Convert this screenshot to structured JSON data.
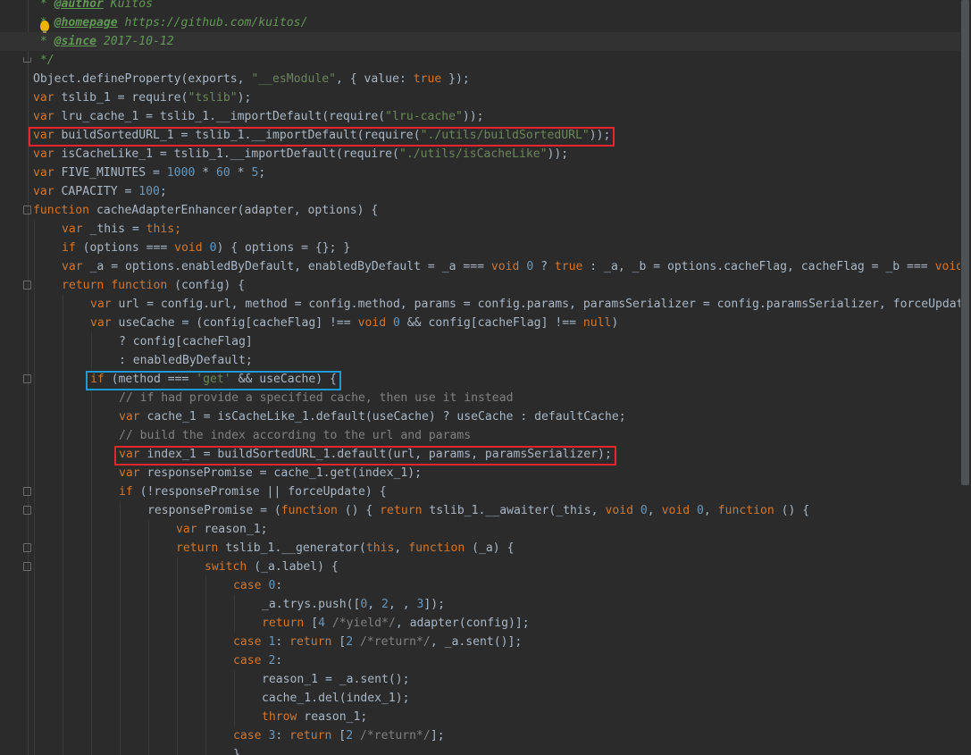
{
  "editor": {
    "lines": [
      {
        "indent": 0,
        "fold": "",
        "current": false,
        "spans": [
          {
            "t": " * ",
            "c": "dcmt"
          },
          {
            "t": "@author",
            "c": "dtag"
          },
          {
            "t": " Kuitos",
            "c": "dcmt"
          }
        ]
      },
      {
        "indent": 0,
        "fold": "",
        "current": false,
        "spans": [
          {
            "t": " * ",
            "c": "dcmt"
          },
          {
            "t": "@homepage",
            "c": "dtag"
          },
          {
            "t": " https://github.com/kuitos/",
            "c": "dcmt"
          }
        ]
      },
      {
        "indent": 0,
        "fold": "",
        "current": true,
        "spans": [
          {
            "t": " * ",
            "c": "dcmt"
          },
          {
            "t": "@since",
            "c": "dtag"
          },
          {
            "t": " 2017-10-12",
            "c": "dcmt"
          }
        ]
      },
      {
        "indent": 0,
        "fold": "end",
        "current": false,
        "spans": [
          {
            "t": " */",
            "c": "dcmt"
          }
        ]
      },
      {
        "indent": 0,
        "fold": "",
        "current": false,
        "spans": [
          {
            "t": "Object.defineProperty(exports, ",
            "c": ""
          },
          {
            "t": "\"__esModule\"",
            "c": "str"
          },
          {
            "t": ", { value: ",
            "c": ""
          },
          {
            "t": "true",
            "c": "kw"
          },
          {
            "t": " });",
            "c": ""
          }
        ]
      },
      {
        "indent": 0,
        "fold": "",
        "current": false,
        "spans": [
          {
            "t": "var",
            "c": "kw"
          },
          {
            "t": " tslib_1 = require(",
            "c": ""
          },
          {
            "t": "\"tslib\"",
            "c": "str"
          },
          {
            "t": ");",
            "c": ""
          }
        ]
      },
      {
        "indent": 0,
        "fold": "",
        "current": false,
        "spans": [
          {
            "t": "var",
            "c": "kw"
          },
          {
            "t": " lru_cache_1 = tslib_1.__importDefault(require(",
            "c": ""
          },
          {
            "t": "\"lru-cache\"",
            "c": "str"
          },
          {
            "t": "));",
            "c": ""
          }
        ]
      },
      {
        "indent": 0,
        "fold": "",
        "current": false,
        "spans": [
          {
            "t": "var",
            "c": "kw"
          },
          {
            "t": " buildSortedURL_1 = tslib_1.__importDefault(require(",
            "c": ""
          },
          {
            "t": "\"./utils/buildSortedURL\"",
            "c": "str"
          },
          {
            "t": "));",
            "c": ""
          }
        ]
      },
      {
        "indent": 0,
        "fold": "",
        "current": false,
        "spans": [
          {
            "t": "var",
            "c": "kw"
          },
          {
            "t": " isCacheLike_1 = tslib_1.__importDefault(require(",
            "c": ""
          },
          {
            "t": "\"./utils/isCacheLike\"",
            "c": "str"
          },
          {
            "t": "));",
            "c": ""
          }
        ]
      },
      {
        "indent": 0,
        "fold": "",
        "current": false,
        "spans": [
          {
            "t": "var",
            "c": "kw"
          },
          {
            "t": " FIVE_MINUTES = ",
            "c": ""
          },
          {
            "t": "1000",
            "c": "num"
          },
          {
            "t": " * ",
            "c": ""
          },
          {
            "t": "60",
            "c": "num"
          },
          {
            "t": " * ",
            "c": ""
          },
          {
            "t": "5",
            "c": "num"
          },
          {
            "t": ";",
            "c": ""
          }
        ]
      },
      {
        "indent": 0,
        "fold": "",
        "current": false,
        "spans": [
          {
            "t": "var",
            "c": "kw"
          },
          {
            "t": " CAPACITY = ",
            "c": ""
          },
          {
            "t": "100",
            "c": "num"
          },
          {
            "t": ";",
            "c": ""
          }
        ]
      },
      {
        "indent": 0,
        "fold": "start",
        "current": false,
        "spans": [
          {
            "t": "function",
            "c": "kw"
          },
          {
            "t": " cacheAdapterEnhancer(adapter, options) {",
            "c": ""
          }
        ]
      },
      {
        "indent": 1,
        "fold": "",
        "current": false,
        "spans": [
          {
            "t": "var",
            "c": "kw"
          },
          {
            "t": " _this = ",
            "c": ""
          },
          {
            "t": "this",
            "c": "kw"
          },
          {
            "t": ";",
            "c": "kw"
          }
        ]
      },
      {
        "indent": 1,
        "fold": "",
        "current": false,
        "spans": [
          {
            "t": "if",
            "c": "kw"
          },
          {
            "t": " (options === ",
            "c": ""
          },
          {
            "t": "void",
            "c": "kw"
          },
          {
            "t": " ",
            "c": ""
          },
          {
            "t": "0",
            "c": "num"
          },
          {
            "t": ") { options = {}; }",
            "c": ""
          }
        ]
      },
      {
        "indent": 1,
        "fold": "",
        "current": false,
        "spans": [
          {
            "t": "var",
            "c": "kw"
          },
          {
            "t": " _a = options.enabledByDefault, enabledByDefault = _a === ",
            "c": ""
          },
          {
            "t": "void",
            "c": "kw"
          },
          {
            "t": " ",
            "c": ""
          },
          {
            "t": "0",
            "c": "num"
          },
          {
            "t": " ? ",
            "c": ""
          },
          {
            "t": "true",
            "c": "kw"
          },
          {
            "t": " : _a, _b = options.cacheFlag, cacheFlag = _b === ",
            "c": ""
          },
          {
            "t": "void",
            "c": "kw"
          }
        ]
      },
      {
        "indent": 1,
        "fold": "start",
        "current": false,
        "spans": [
          {
            "t": "return",
            "c": "kw"
          },
          {
            "t": " ",
            "c": ""
          },
          {
            "t": "function",
            "c": "kw"
          },
          {
            "t": " (config) {",
            "c": ""
          }
        ]
      },
      {
        "indent": 2,
        "fold": "",
        "current": false,
        "spans": [
          {
            "t": "var",
            "c": "kw"
          },
          {
            "t": " url = config.url, method = config.method, params = config.params, paramsSerializer = config.paramsSerializer, forceUpdate",
            "c": ""
          }
        ]
      },
      {
        "indent": 2,
        "fold": "",
        "current": false,
        "spans": [
          {
            "t": "var",
            "c": "kw"
          },
          {
            "t": " useCache = (config[cacheFlag] !== ",
            "c": ""
          },
          {
            "t": "void",
            "c": "kw"
          },
          {
            "t": " ",
            "c": ""
          },
          {
            "t": "0",
            "c": "num"
          },
          {
            "t": " && config[cacheFlag] !== ",
            "c": ""
          },
          {
            "t": "null",
            "c": "kw"
          },
          {
            "t": ")",
            "c": ""
          }
        ]
      },
      {
        "indent": 3,
        "fold": "",
        "current": false,
        "spans": [
          {
            "t": "? config[cacheFlag]",
            "c": ""
          }
        ]
      },
      {
        "indent": 3,
        "fold": "",
        "current": false,
        "spans": [
          {
            "t": ": enabledByDefault;",
            "c": ""
          }
        ]
      },
      {
        "indent": 2,
        "fold": "start",
        "current": false,
        "spans": [
          {
            "t": "if",
            "c": "kw"
          },
          {
            "t": " (method === ",
            "c": ""
          },
          {
            "t": "'get'",
            "c": "str"
          },
          {
            "t": " && useCache) {",
            "c": ""
          }
        ]
      },
      {
        "indent": 3,
        "fold": "",
        "current": false,
        "spans": [
          {
            "t": "// if had provide a specified cache, then use it instead",
            "c": "cmt"
          }
        ]
      },
      {
        "indent": 3,
        "fold": "",
        "current": false,
        "spans": [
          {
            "t": "var",
            "c": "kw"
          },
          {
            "t": " cache_1 = isCacheLike_1.default(useCache) ? useCache : defaultCache;",
            "c": ""
          }
        ]
      },
      {
        "indent": 3,
        "fold": "",
        "current": false,
        "spans": [
          {
            "t": "// build the index according to the url and params",
            "c": "cmt"
          }
        ]
      },
      {
        "indent": 3,
        "fold": "",
        "current": false,
        "spans": [
          {
            "t": "var",
            "c": "kw"
          },
          {
            "t": " index_1 = buildSortedURL_1.default(url, params, paramsSerializer);",
            "c": ""
          }
        ]
      },
      {
        "indent": 3,
        "fold": "",
        "current": false,
        "spans": [
          {
            "t": "var",
            "c": "kw"
          },
          {
            "t": " responsePromise = cache_1.get(index_1);",
            "c": ""
          }
        ]
      },
      {
        "indent": 3,
        "fold": "start",
        "current": false,
        "spans": [
          {
            "t": "if",
            "c": "kw"
          },
          {
            "t": " (!responsePromise || forceUpdate) {",
            "c": ""
          }
        ]
      },
      {
        "indent": 4,
        "fold": "start",
        "current": false,
        "spans": [
          {
            "t": "responsePromise = (",
            "c": ""
          },
          {
            "t": "function",
            "c": "kw"
          },
          {
            "t": " () { ",
            "c": ""
          },
          {
            "t": "return",
            "c": "kw"
          },
          {
            "t": " tslib_1.__awaiter(_this, ",
            "c": ""
          },
          {
            "t": "void",
            "c": "kw"
          },
          {
            "t": " ",
            "c": ""
          },
          {
            "t": "0",
            "c": "num"
          },
          {
            "t": ", ",
            "c": ""
          },
          {
            "t": "void",
            "c": "kw"
          },
          {
            "t": " ",
            "c": ""
          },
          {
            "t": "0",
            "c": "num"
          },
          {
            "t": ", ",
            "c": ""
          },
          {
            "t": "function",
            "c": "kw"
          },
          {
            "t": " () {",
            "c": ""
          }
        ]
      },
      {
        "indent": 5,
        "fold": "",
        "current": false,
        "spans": [
          {
            "t": "var",
            "c": "kw"
          },
          {
            "t": " reason_1;",
            "c": ""
          }
        ]
      },
      {
        "indent": 5,
        "fold": "start",
        "current": false,
        "spans": [
          {
            "t": "return",
            "c": "kw"
          },
          {
            "t": " tslib_1.__generator(",
            "c": ""
          },
          {
            "t": "this",
            "c": "kw"
          },
          {
            "t": ", ",
            "c": ""
          },
          {
            "t": "function",
            "c": "kw"
          },
          {
            "t": " (_a) {",
            "c": ""
          }
        ]
      },
      {
        "indent": 6,
        "fold": "start",
        "current": false,
        "spans": [
          {
            "t": "switch",
            "c": "kw"
          },
          {
            "t": " (_a.label) {",
            "c": ""
          }
        ]
      },
      {
        "indent": 7,
        "fold": "",
        "current": false,
        "spans": [
          {
            "t": "case",
            "c": "kw"
          },
          {
            "t": " ",
            "c": ""
          },
          {
            "t": "0",
            "c": "num"
          },
          {
            "t": ":",
            "c": ""
          }
        ]
      },
      {
        "indent": 8,
        "fold": "",
        "current": false,
        "spans": [
          {
            "t": "_a.trys.push([",
            "c": ""
          },
          {
            "t": "0",
            "c": "num"
          },
          {
            "t": ", ",
            "c": ""
          },
          {
            "t": "2",
            "c": "num"
          },
          {
            "t": ", , ",
            "c": ""
          },
          {
            "t": "3",
            "c": "num"
          },
          {
            "t": "]);",
            "c": ""
          }
        ]
      },
      {
        "indent": 8,
        "fold": "",
        "current": false,
        "spans": [
          {
            "t": "return",
            "c": "kw"
          },
          {
            "t": " [",
            "c": ""
          },
          {
            "t": "4",
            "c": "num"
          },
          {
            "t": " ",
            "c": ""
          },
          {
            "t": "/*yield*/",
            "c": "cmt"
          },
          {
            "t": ", adapter(config)];",
            "c": ""
          }
        ]
      },
      {
        "indent": 7,
        "fold": "",
        "current": false,
        "spans": [
          {
            "t": "case",
            "c": "kw"
          },
          {
            "t": " ",
            "c": ""
          },
          {
            "t": "1",
            "c": "num"
          },
          {
            "t": ": ",
            "c": ""
          },
          {
            "t": "return",
            "c": "kw"
          },
          {
            "t": " [",
            "c": ""
          },
          {
            "t": "2",
            "c": "num"
          },
          {
            "t": " ",
            "c": ""
          },
          {
            "t": "/*return*/",
            "c": "cmt"
          },
          {
            "t": ", _a.sent()];",
            "c": ""
          }
        ]
      },
      {
        "indent": 7,
        "fold": "",
        "current": false,
        "spans": [
          {
            "t": "case",
            "c": "kw"
          },
          {
            "t": " ",
            "c": ""
          },
          {
            "t": "2",
            "c": "num"
          },
          {
            "t": ":",
            "c": ""
          }
        ]
      },
      {
        "indent": 8,
        "fold": "",
        "current": false,
        "spans": [
          {
            "t": "reason_1 = _a.sent();",
            "c": ""
          }
        ]
      },
      {
        "indent": 8,
        "fold": "",
        "current": false,
        "spans": [
          {
            "t": "cache_1.del(index_1);",
            "c": ""
          }
        ]
      },
      {
        "indent": 8,
        "fold": "",
        "current": false,
        "spans": [
          {
            "t": "throw",
            "c": "kw"
          },
          {
            "t": " reason_1;",
            "c": ""
          }
        ]
      },
      {
        "indent": 7,
        "fold": "",
        "current": false,
        "spans": [
          {
            "t": "case",
            "c": "kw"
          },
          {
            "t": " ",
            "c": ""
          },
          {
            "t": "3",
            "c": "num"
          },
          {
            "t": ": ",
            "c": ""
          },
          {
            "t": "return",
            "c": "kw"
          },
          {
            "t": " [",
            "c": ""
          },
          {
            "t": "2",
            "c": "num"
          },
          {
            "t": " ",
            "c": ""
          },
          {
            "t": "/*return*/",
            "c": "cmt"
          },
          {
            "t": "];",
            "c": ""
          }
        ]
      },
      {
        "indent": 7,
        "fold": "",
        "current": false,
        "spans": [
          {
            "t": "}",
            "c": ""
          }
        ]
      }
    ],
    "highlights": [
      {
        "line": 7,
        "color": "red"
      },
      {
        "line": 20,
        "color": "blue"
      },
      {
        "line": 24,
        "color": "red"
      }
    ],
    "gutter_icon": "intention-bulb-icon"
  }
}
